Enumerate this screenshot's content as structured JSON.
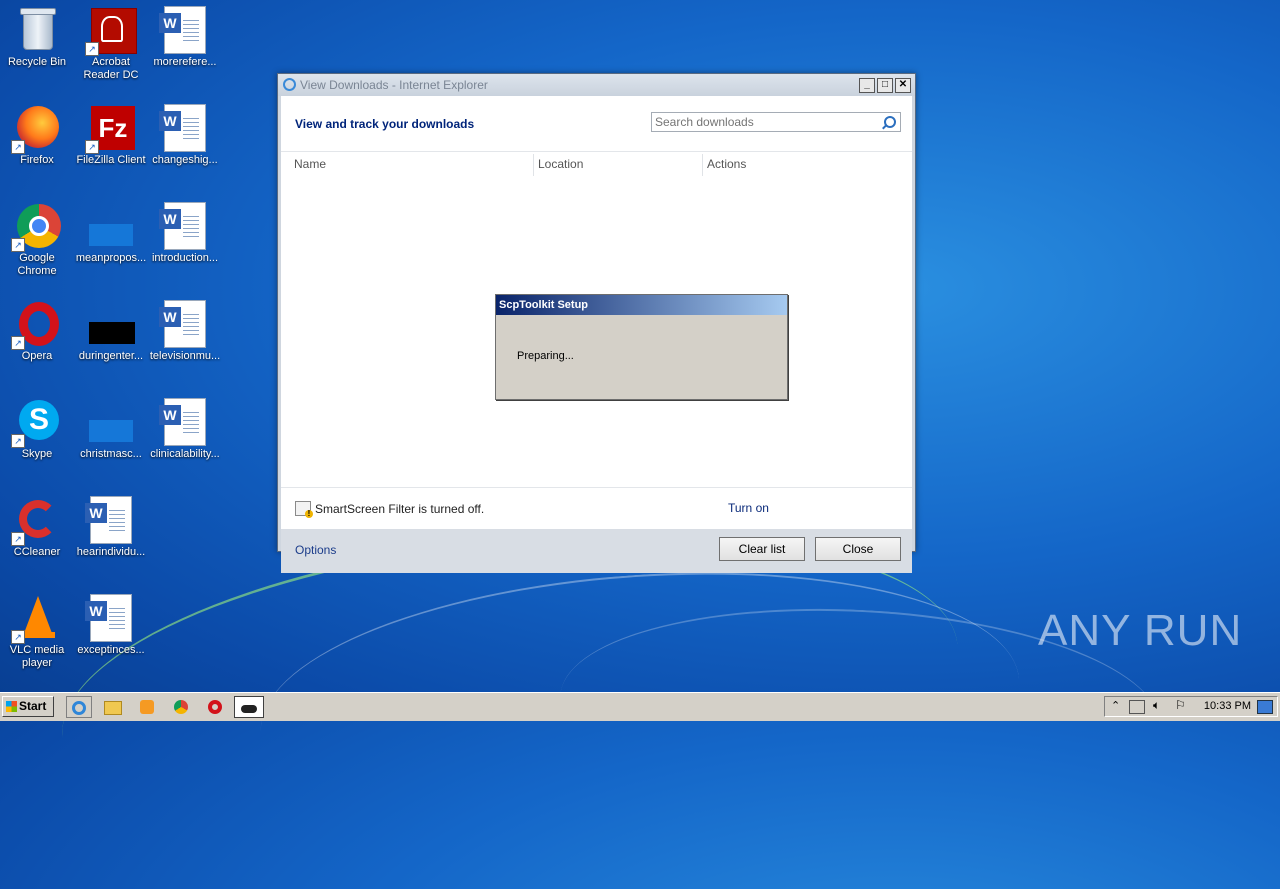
{
  "desktop": {
    "icons": [
      {
        "label": "Recycle Bin",
        "icon": "recycle-bin-icon"
      },
      {
        "label": "Acrobat Reader DC",
        "icon": "acrobat-icon"
      },
      {
        "label": "morerefere...",
        "icon": "word-doc-icon"
      },
      {
        "label": "Firefox",
        "icon": "firefox-icon"
      },
      {
        "label": "FileZilla Client",
        "icon": "filezilla-icon"
      },
      {
        "label": "changeshig...",
        "icon": "word-doc-icon"
      },
      {
        "label": "Google Chrome",
        "icon": "chrome-icon"
      },
      {
        "label": "meanpropos...",
        "icon": "blank-file-icon"
      },
      {
        "label": "introduction...",
        "icon": "word-doc-icon"
      },
      {
        "label": "Opera",
        "icon": "opera-icon"
      },
      {
        "label": "duringenter...",
        "icon": "black-file-icon"
      },
      {
        "label": "televisionmu...",
        "icon": "word-doc-icon"
      },
      {
        "label": "Skype",
        "icon": "skype-icon"
      },
      {
        "label": "christmasc...",
        "icon": "blank-file-icon"
      },
      {
        "label": "clinicalability...",
        "icon": "word-doc-icon"
      },
      {
        "label": "CCleaner",
        "icon": "ccleaner-icon"
      },
      {
        "label": "hearindividu...",
        "icon": "word-doc-icon"
      },
      {
        "label": "VLC media player",
        "icon": "vlc-icon"
      },
      {
        "label": "exceptinces...",
        "icon": "word-doc-icon"
      }
    ],
    "watermark": "ANY RUN"
  },
  "ie_window": {
    "title": "View Downloads - Internet Explorer",
    "heading": "View and track your downloads",
    "search_placeholder": "Search downloads",
    "columns": [
      "Name",
      "Location",
      "Actions"
    ],
    "smartscreen_text": "SmartScreen Filter is turned off.",
    "turn_on": "Turn on",
    "options": "Options",
    "clear_list": "Clear list",
    "close": "Close"
  },
  "setup_dialog": {
    "title": "ScpToolkit Setup",
    "message": "Preparing..."
  },
  "taskbar": {
    "start": "Start",
    "clock": "10:33 PM"
  }
}
